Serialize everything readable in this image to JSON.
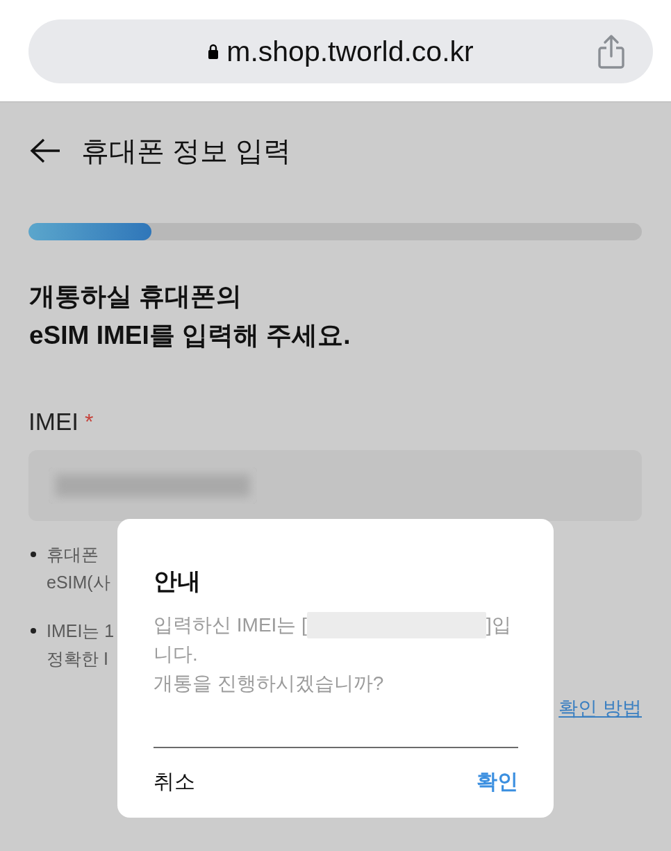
{
  "browser": {
    "url": "m.shop.tworld.co.kr",
    "secure": true
  },
  "header": {
    "title": "휴대폰 정보 입력"
  },
  "progress": {
    "level": 0.2
  },
  "heading": "개통하실 휴대폰의\neSIM IMEI를 입력해 주세요.",
  "field": {
    "label": "IMEI",
    "required_mark": "*"
  },
  "notes": [
    {
      "lines": [
        "휴대폰",
        "eSIM(사"
      ]
    },
    {
      "lines": [
        "IMEI는 1",
        "정확한 I"
      ]
    }
  ],
  "help_link": {
    "text": "확인 방법"
  },
  "dialog": {
    "title": "안내",
    "message_lines": [
      [
        {
          "kind": "text",
          "text": "입력하신 IMEI는 ["
        },
        {
          "kind": "redacted"
        },
        {
          "kind": "text",
          "text": "]입"
        }
      ],
      [
        {
          "kind": "text",
          "text": "니다."
        }
      ],
      [
        {
          "kind": "text",
          "text": "개통을 진행하시겠습니까?"
        }
      ]
    ],
    "buttons": [
      {
        "label": "취소",
        "kind": "cancel"
      },
      {
        "label": "확인",
        "kind": "confirm"
      }
    ]
  }
}
